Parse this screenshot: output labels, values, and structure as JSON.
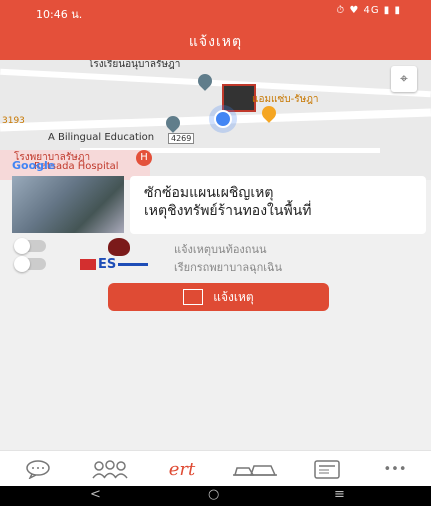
{
  "status_bar": {
    "time": "10:46 น.",
    "indicators": "⏱ ♥ 4G ▮ ▮"
  },
  "header": {
    "title": "แจ้งเหตุ"
  },
  "map": {
    "labels": {
      "school": "โรงเรียนอนุบาลรัษฎา",
      "restaurant": "แอมแซ่บ-รัษฎา",
      "route": "3193",
      "bilingual": "A Bilingual Education",
      "road_number": "4269",
      "hospital_th": "โรงพยาบาลรัษฎา",
      "hospital_en": "Ratsada Hospital",
      "google": "Google"
    }
  },
  "news": {
    "line1": "ซักซ้อมแผนเผชิญเหตุ",
    "line2": "เหตุชิงทรัพย์ร้านทองในพื้นที่"
  },
  "options": [
    {
      "label": "แจ้งเหตุบนท้องถนน",
      "logo": "shield-logo"
    },
    {
      "label": "เรียกรถพยาบาลฉุกเฉิน",
      "logo": "EES",
      "logo_text": "ES"
    }
  ],
  "report_button": {
    "label": "แจ้งเหตุ"
  },
  "bottom_nav": [
    {
      "name": "chat",
      "icon": "chat-bubble-icon"
    },
    {
      "name": "people",
      "icon": "people-icon"
    },
    {
      "name": "alert",
      "icon": "alert-brand-icon",
      "label": "ert"
    },
    {
      "name": "vehicles",
      "icon": "vehicles-icon"
    },
    {
      "name": "news",
      "icon": "newspaper-icon"
    },
    {
      "name": "more",
      "icon": "more-icon",
      "label": "•••"
    }
  ],
  "system_nav": {
    "back": "<",
    "home": "○",
    "recents": "≡"
  },
  "colors": {
    "primary": "#e4503a",
    "button": "#df4b34"
  }
}
